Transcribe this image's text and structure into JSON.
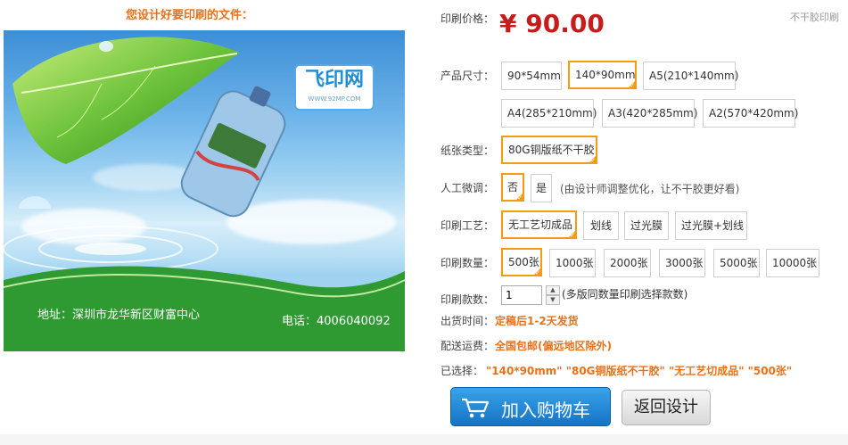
{
  "preview": {
    "title": "您设计好要印刷的文件：",
    "logo_text": "飞印网",
    "logo_url": "WWW.92MP.COM",
    "address": "地址：深圳市龙华新区财富中心",
    "phone": "电话：4006040092"
  },
  "price": {
    "label": "印刷价格：",
    "value": "¥ 90.00",
    "note": "不干胶印刷"
  },
  "size": {
    "label": "产品尺寸：",
    "options": [
      "90*54mm",
      "140*90mm",
      "A5(210*140mm)",
      "A4(285*210mm)",
      "A3(420*285mm)",
      "A2(570*420mm)"
    ],
    "selected": "140*90mm"
  },
  "paper": {
    "label": "纸张类型：",
    "options": [
      "80G铜版纸不干胶"
    ],
    "selected": "80G铜版纸不干胶"
  },
  "manual": {
    "label": "人工微调：",
    "options": [
      "否",
      "是"
    ],
    "selected": "否",
    "hint": "(由设计师调整优化，让不干胶更好看)"
  },
  "craft": {
    "label": "印刷工艺：",
    "options": [
      "无工艺切成品",
      "划线",
      "过光膜",
      "过光膜+划线"
    ],
    "selected": "无工艺切成品"
  },
  "quantity": {
    "label": "印刷数量：",
    "options": [
      "500张",
      "1000张",
      "2000张",
      "3000张",
      "5000张",
      "10000张"
    ],
    "selected": "500张"
  },
  "copies": {
    "label": "印刷款数：",
    "value": "1",
    "hint": "(多版同数量印刷选择款数)"
  },
  "delivery": {
    "label": "出货时间：",
    "value": "定稿后1-2天发货"
  },
  "shipping": {
    "label": "配送运费：",
    "value": "全国包邮(偏远地区除外)"
  },
  "summary": {
    "label": "已选择：",
    "value": "\"140*90mm\" \"80G铜版纸不干胶\" \"无工艺切成品\" \"500张\""
  },
  "buttons": {
    "cart": "加入购物车",
    "back": "返回设计"
  },
  "colors": {
    "price": "#c81b1b",
    "accent": "#e8711a",
    "selected_border": "#f39c12",
    "cart_button": "#1e84d4"
  },
  "icons": [
    "cart-icon",
    "check-icon",
    "spin-up-icon",
    "spin-down-icon"
  ]
}
